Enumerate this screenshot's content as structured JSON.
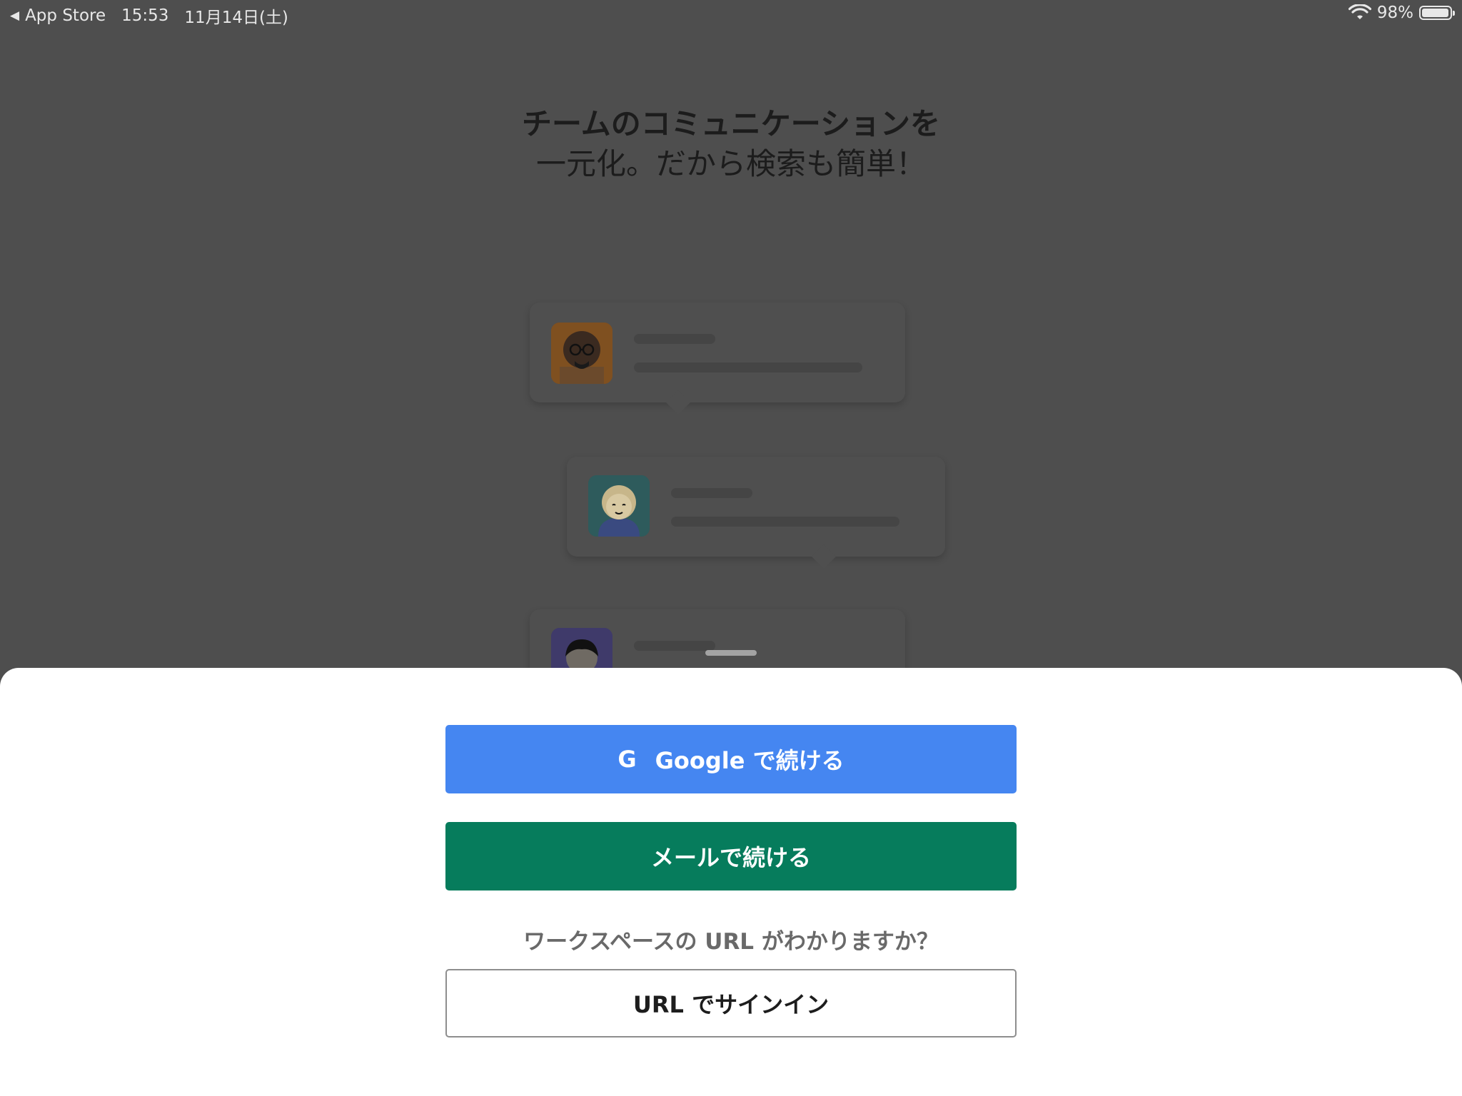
{
  "status_bar": {
    "back_app": "App Store",
    "time": "15:53",
    "date": "11月14日(土)",
    "battery_text": "98%",
    "battery_level": 0.98
  },
  "headline": {
    "line1": "チームのコミュニケーションを",
    "line2": "一元化。だから検索も簡単！"
  },
  "sheet": {
    "google_icon": "G",
    "google_button": "Google で続ける",
    "email_button": "メールで続ける",
    "workspace_question": "ワークスペースの URL がわかりますか？",
    "url_button": "URL でサインイン"
  },
  "colors": {
    "google_blue": "#4586f1",
    "email_green": "#067c5c",
    "overlay_dim": "#4e4e4e"
  }
}
